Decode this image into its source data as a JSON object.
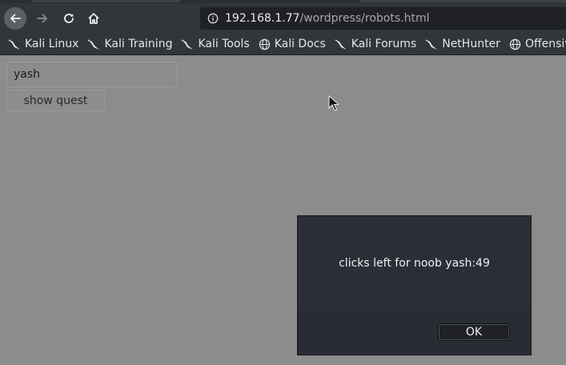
{
  "browser": {
    "url_host": "192.168.1.77",
    "url_path": "/wordpress/robots.html",
    "bookmarks": [
      {
        "label": "Kali Linux",
        "icon": "kali-dragon-icon"
      },
      {
        "label": "Kali Training",
        "icon": "kali-dragon-icon"
      },
      {
        "label": "Kali Tools",
        "icon": "kali-dragon-icon"
      },
      {
        "label": "Kali Docs",
        "icon": "globe-icon"
      },
      {
        "label": "Kali Forums",
        "icon": "kali-dragon-icon"
      },
      {
        "label": "NetHunter",
        "icon": "kali-dragon-icon"
      },
      {
        "label": "Offensive",
        "icon": "globe-icon"
      }
    ]
  },
  "page": {
    "name_input_value": "yash",
    "show_button_label": "show quest"
  },
  "dialog": {
    "message": "clicks left for noob yash:49",
    "ok_label": "OK"
  },
  "colors": {
    "page_overlay": "#8c8c8c",
    "chrome": "#323639",
    "dialog_bg": "#2b2e36"
  }
}
